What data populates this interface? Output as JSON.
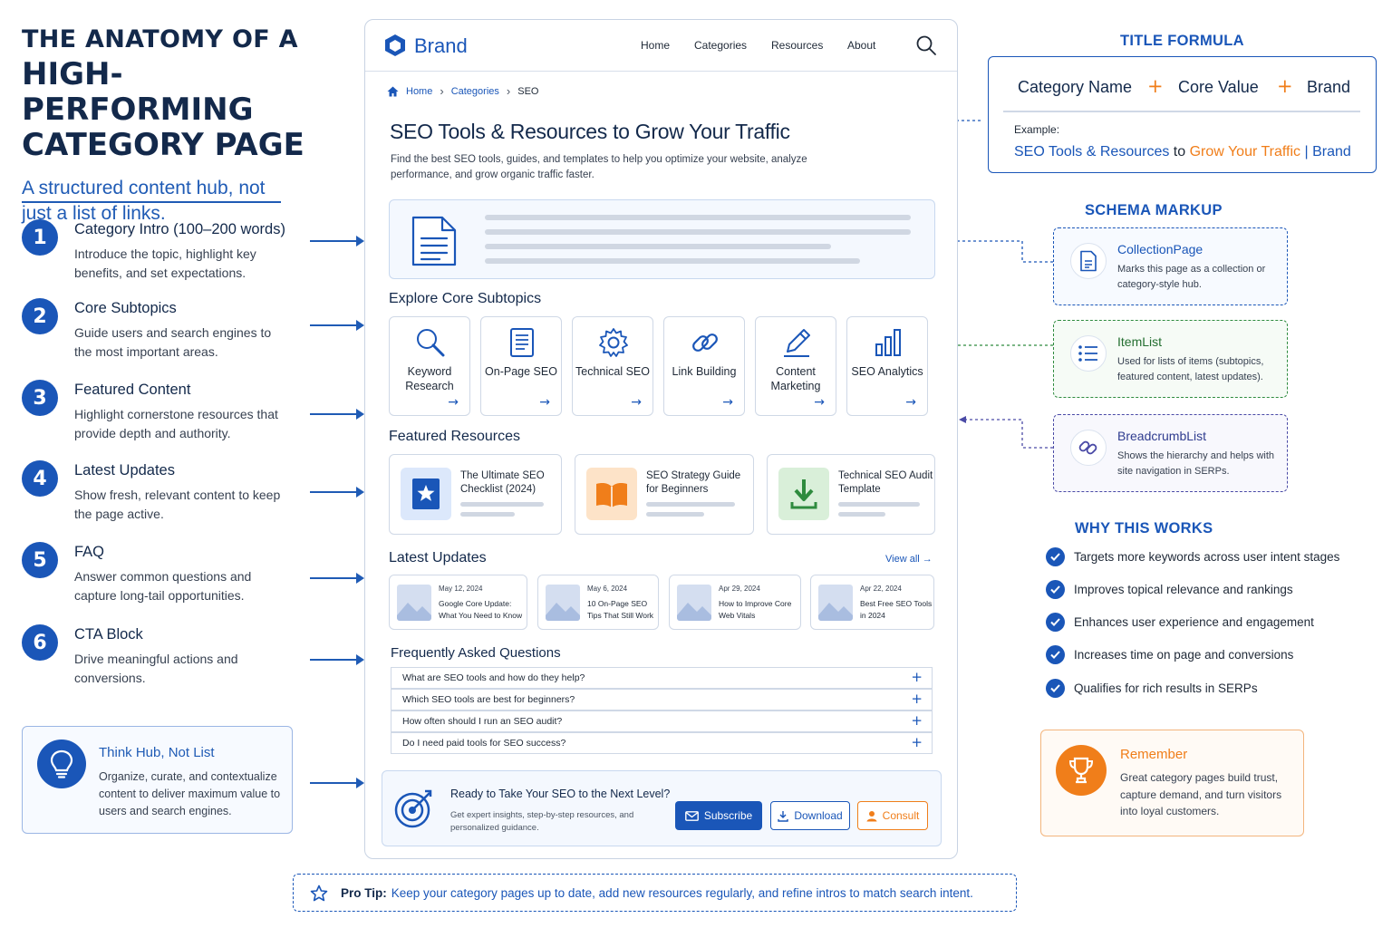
{
  "colors": {
    "navy": "#13294b",
    "blue": "#1a56b8",
    "orange": "#f07e1a",
    "green": "#2e8b3e",
    "purple": "#4a4aa6"
  },
  "header": {
    "title_line1": "THE ANATOMY OF A",
    "title_line2": "HIGH-PERFORMING",
    "title_line3": "CATEGORY PAGE",
    "subtitle": "A structured content hub, not just a list of links."
  },
  "steps": [
    {
      "num": "1",
      "title": "Category Intro (100–200 words)",
      "desc": "Introduce the topic, highlight key benefits, and set expectations."
    },
    {
      "num": "2",
      "title": "Core Subtopics",
      "desc": "Guide users and search engines to the most important areas."
    },
    {
      "num": "3",
      "title": "Featured Content",
      "desc": "Highlight cornerstone resources that provide depth and authority."
    },
    {
      "num": "4",
      "title": "Latest Updates",
      "desc": "Show fresh, relevant content to keep the page active."
    },
    {
      "num": "5",
      "title": "FAQ",
      "desc": "Answer common questions and capture long-tail opportunities."
    },
    {
      "num": "6",
      "title": "CTA Block",
      "desc": "Drive meaningful actions and conversions."
    }
  ],
  "hub_card": {
    "icon": "lightbulb-icon",
    "title": "Think Hub, Not List",
    "desc": "Organize, curate, and contextualize content to deliver maximum value to users and search engines."
  },
  "mockup": {
    "brand": "Brand",
    "nav": [
      "Home",
      "Categories",
      "Resources",
      "About"
    ],
    "breadcrumb": [
      "Home",
      "Categories",
      "SEO"
    ],
    "h1": "SEO Tools & Resources to Grow Your Traffic",
    "intro": "Find the best SEO tools, guides, and templates to help you optimize your website, analyze performance, and grow organic traffic faster.",
    "subtopics_heading": "Explore Core Subtopics",
    "subtopics": [
      {
        "label": "Keyword Research",
        "icon": "magnifier-icon"
      },
      {
        "label": "On-Page SEO",
        "icon": "document-icon"
      },
      {
        "label": "Technical SEO",
        "icon": "gear-icon"
      },
      {
        "label": "Link Building",
        "icon": "link-icon"
      },
      {
        "label": "Content Marketing",
        "icon": "pencil-icon"
      },
      {
        "label": "SEO Analytics",
        "icon": "bar-chart-icon"
      }
    ],
    "featured_heading": "Featured Resources",
    "featured": [
      {
        "title": "The Ultimate SEO Checklist (2024)",
        "icon": "star-icon"
      },
      {
        "title": "SEO Strategy Guide for Beginners",
        "icon": "book-icon"
      },
      {
        "title": "Technical SEO Audit Template",
        "icon": "download-icon"
      }
    ],
    "updates_heading": "Latest Updates",
    "view_all": "View all →",
    "updates": [
      {
        "date": "May 12, 2024",
        "title": "Google Core Update: What You Need to Know"
      },
      {
        "date": "May 6, 2024",
        "title": "10 On-Page SEO Tips That Still Work"
      },
      {
        "date": "Apr 29, 2024",
        "title": "How to Improve Core Web Vitals"
      },
      {
        "date": "Apr 22, 2024",
        "title": "Best Free SEO Tools in 2024"
      }
    ],
    "faq_heading": "Frequently Asked Questions",
    "faq": [
      "What are SEO tools and how do they help?",
      "Which SEO tools are best for beginners?",
      "How often should I run an SEO audit?",
      "Do I need paid tools for SEO success?"
    ],
    "cta": {
      "title": "Ready to Take Your SEO to the Next Level?",
      "desc": "Get expert insights, step-by-step resources, and personalized guidance.",
      "subscribe": "Subscribe",
      "download": "Download",
      "consult": "Consult"
    }
  },
  "title_formula": {
    "heading": "TITLE FORMULA",
    "parts": [
      "Category Name",
      "Core Value",
      "Brand"
    ],
    "example_label": "Example:",
    "example_a": "SEO Tools & Resources",
    "example_to": " to ",
    "example_b": "Grow Your Traffic",
    "example_sep": " | ",
    "example_c": "Brand"
  },
  "schema": {
    "heading": "SCHEMA MARKUP",
    "items": [
      {
        "title": "CollectionPage",
        "desc": "Marks this page as a collection or category-style hub.",
        "icon": "collection-doc-icon"
      },
      {
        "title": "ItemList",
        "desc": "Used for lists of items (subtopics, featured content, latest updates).",
        "icon": "list-icon"
      },
      {
        "title": "BreadcrumbList",
        "desc": "Shows the hierarchy and helps with site navigation in SERPs.",
        "icon": "breadcrumb-link-icon"
      }
    ]
  },
  "why": {
    "heading": "WHY THIS WORKS",
    "items": [
      "Targets more keywords across user intent stages",
      "Improves topical relevance and rankings",
      "Enhances user experience and engagement",
      "Increases time on page and conversions",
      "Qualifies for rich results in SERPs"
    ]
  },
  "remember": {
    "icon": "trophy-icon",
    "title": "Remember",
    "desc": "Great category pages build trust, capture demand, and turn visitors into loyal customers."
  },
  "protip": {
    "label": "Pro Tip:",
    "text": "Keep your category pages up to date, add new resources regularly, and refine intros to match search intent."
  }
}
